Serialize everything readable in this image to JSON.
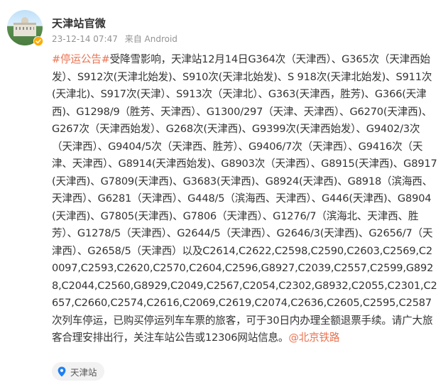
{
  "post": {
    "user_name": "天津站官微",
    "timestamp": "23-12-14 07:47",
    "source": "来自 Android",
    "hashtag": "#停运公告#",
    "body": "受降雪影响，天津站12月14日G364次（天津西）、G365次（天津西始发）、S912次(天津北始发)、S910次(天津北始发)、S 918次(天津北始发)、S911次(天津北)、S917次(天津）、S913次（天津北）、G363(天津西，胜芳)、G366(天津西)、G1298/9（胜芳、天津西）、G1300/297（天津、天津西）、G6270(天津西)、G267次（天津西始发）、G268次(天津西)、G9399次(天津西始发）、G9402/3次（天津西）、G9404/5次（天津西、胜芳）、G9406/7次（天津西）、G9416次（天津、天津西）、G8914(天津西始发)、G8903次（天津西）、G8915(天津西)、G8917(天津西)、G7809(天津西)、G3683(天津西)、G8924(天津西)、G8918（滨海西、天津西）、G6281（天津西）、G448/5（滨海西、天津西）、G446(天津西)、G8904(天津西)、G7805(天津西)、G7806（天津西）、G1276/7（滨海北、天津西、胜芳）、G1278/5（天津西）、G2644/5（天津西）、G2646/3(天津西)、G2656/7（天津西）、G2658/5（天津西）以及C2614,C2622,C2598,C2590,C2603,C2569,C20097,C2593,C2620,C2570,C2604,C2596,G8927,C2039,C2557,C2599,G8928,C2044,C2560,G8929,C2049,C2567,C2054,C2302,G8932,C2055,C2301,C2657,C2660,C2574,C2616,C2069,C2619,C2074,C2636,C2605,C2595,C2587次列车停运，已购买停运列车车票的旅客，可于30日内办理全额退票手续。请广大旅客合理安排出行，关注车站公告或12306网站信息。",
    "mention": "@北京铁路",
    "location": "天津站"
  },
  "colors": {
    "link": "#eb7350",
    "verified_badge": "#ffab00",
    "location_icon": "#1f7ff0"
  },
  "icons": {
    "verified": "verified-badge-icon",
    "location": "location-pin-icon"
  }
}
